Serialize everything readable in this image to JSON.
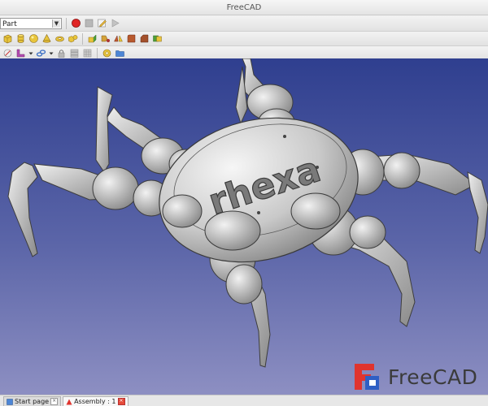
{
  "window": {
    "title": "FreeCAD"
  },
  "toolbar": {
    "workbench": "Part"
  },
  "model": {
    "label": "rhexa"
  },
  "tabs": [
    {
      "label": "Start page",
      "active": false
    },
    {
      "label": "Assembly : 1",
      "active": true
    }
  ],
  "logo": {
    "text": "FreeCAD"
  },
  "colors": {
    "viewport_top": "#2f3f8f",
    "viewport_bottom": "#8d8fc2",
    "logo_red": "#e0342e",
    "logo_blue": "#2f5fc4"
  }
}
